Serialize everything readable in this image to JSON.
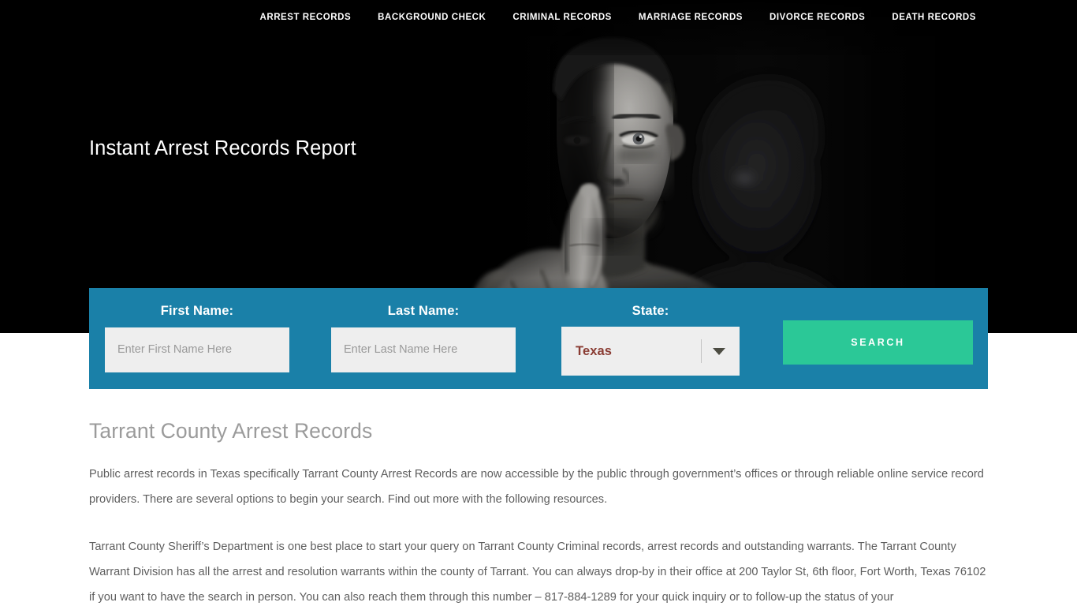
{
  "nav": {
    "items": [
      {
        "label": "ARREST RECORDS",
        "name": "nav-item-arrest-records"
      },
      {
        "label": "BACKGROUND CHECK",
        "name": "nav-item-background-check"
      },
      {
        "label": "CRIMINAL RECORDS",
        "name": "nav-item-criminal-records"
      },
      {
        "label": "MARRIAGE RECORDS",
        "name": "nav-item-marriage-records"
      },
      {
        "label": "DIVORCE RECORDS",
        "name": "nav-item-divorce-records"
      },
      {
        "label": "DEATH RECORDS",
        "name": "nav-item-death-records"
      }
    ]
  },
  "hero": {
    "title": "Instant Arrest Records Report",
    "image_alt": "man-shushing-finger-to-lips-photo"
  },
  "search_form": {
    "first_name": {
      "label": "First Name:",
      "placeholder": "Enter First Name Here",
      "value": ""
    },
    "last_name": {
      "label": "Last Name:",
      "placeholder": "Enter Last Name Here",
      "value": ""
    },
    "state": {
      "label": "State:",
      "selected": "Texas",
      "options": [
        "Texas"
      ]
    },
    "submit_label": "SEARCH"
  },
  "main": {
    "heading": "Tarrant County Arrest Records",
    "paragraph_1": "Public arrest records in Texas specifically Tarrant County Arrest Records are now accessible by the public through government’s offices or through reliable online service record providers. There are several options to begin your search. Find out more with the following resources.",
    "paragraph_2_part_1": "Tarrant County Sheriff’s Department is one best place to start your query on Tarrant County Criminal records, arrest records and outstanding warrants. The Tarrant County Warrant Division has all the arrest and resolution warrants within the county of Tarrant. You can always drop-by in their office at 200 Taylor St, 6th floor, Fort Worth, Texas 76102 if you want to have the search in person. You can also reach them through this number – ",
    "phone": "817-884-1289",
    "paragraph_2_part_2": " for your quick inquiry or to follow-up the status of your"
  },
  "colors": {
    "form_bar_blue": "#1a80a8",
    "search_button_green": "#2bc897",
    "hero_background": "#000000",
    "state_value_text": "#8a3c33",
    "heading_gray": "#9b9b9b",
    "body_gray": "#5e5e5e",
    "input_background": "#eeeeee"
  }
}
